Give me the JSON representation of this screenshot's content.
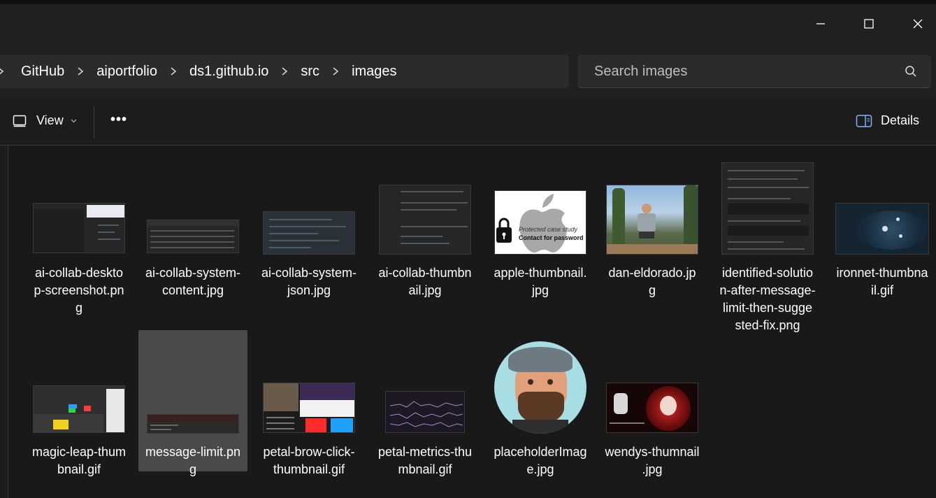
{
  "window": {
    "minimize_icon": "minimize-icon",
    "maximize_icon": "maximize-icon",
    "close_icon": "close-icon"
  },
  "breadcrumb": {
    "items": [
      "GitHub",
      "aiportfolio",
      "ds1.github.io",
      "src",
      "images"
    ]
  },
  "search": {
    "placeholder": "Search images"
  },
  "toolbar": {
    "view_label": "View",
    "more_label": "•••",
    "details_label": "Details"
  },
  "files": [
    {
      "name": "ai-collab-desktop-screenshot.png",
      "lines": [
        "ai-collab-deskto",
        "p-screenshot.pn",
        "g"
      ]
    },
    {
      "name": "ai-collab-system-content.jpg",
      "lines": [
        "ai-collab-system-",
        "content.jpg"
      ]
    },
    {
      "name": "ai-collab-system-json.jpg",
      "lines": [
        "ai-collab-system-",
        "json.jpg"
      ]
    },
    {
      "name": "ai-collab-thumbnail.jpg",
      "lines": [
        "ai-collab-thumbn",
        "ail.jpg"
      ]
    },
    {
      "name": "apple-thumbnail.jpg",
      "lines": [
        "apple-thumbnail.",
        "jpg"
      ],
      "thumb_text": [
        "Protected case study",
        "Contact for password"
      ]
    },
    {
      "name": "dan-eldorado.jpg",
      "lines": [
        "dan-eldorado.jp",
        "g"
      ]
    },
    {
      "name": "identified-solution-after-message-limit-then-suggested-fix.png",
      "lines": [
        "identified-solutio",
        "n-after-message-",
        "limit-then-sugge",
        "sted-fix.png"
      ]
    },
    {
      "name": "ironnet-thumbnail.gif",
      "lines": [
        "ironnet-thumbna",
        "il.gif"
      ]
    },
    {
      "name": "magic-leap-thumbnail.gif",
      "lines": [
        "magic-leap-thum",
        "bnail.gif"
      ]
    },
    {
      "name": "message-limit.png",
      "lines": [
        "message-limit.pn",
        "g"
      ],
      "selected": true
    },
    {
      "name": "petal-brow-click-thumbnail.gif",
      "lines": [
        "petal-brow-click-",
        "thumbnail.gif"
      ]
    },
    {
      "name": "petal-metrics-thumbnail.gif",
      "lines": [
        "petal-metrics-thu",
        "mbnail.gif"
      ]
    },
    {
      "name": "placeholderImage.jpg",
      "lines": [
        "placeholderImag",
        "e.jpg"
      ]
    },
    {
      "name": "wendys-thumnail.jpg",
      "lines": [
        "wendys-thumnail",
        ".jpg"
      ]
    }
  ],
  "colors": {
    "background": "#191919",
    "chrome": "#202020",
    "field": "#2b2b2b",
    "selected_tile": "#4a4a4a"
  }
}
